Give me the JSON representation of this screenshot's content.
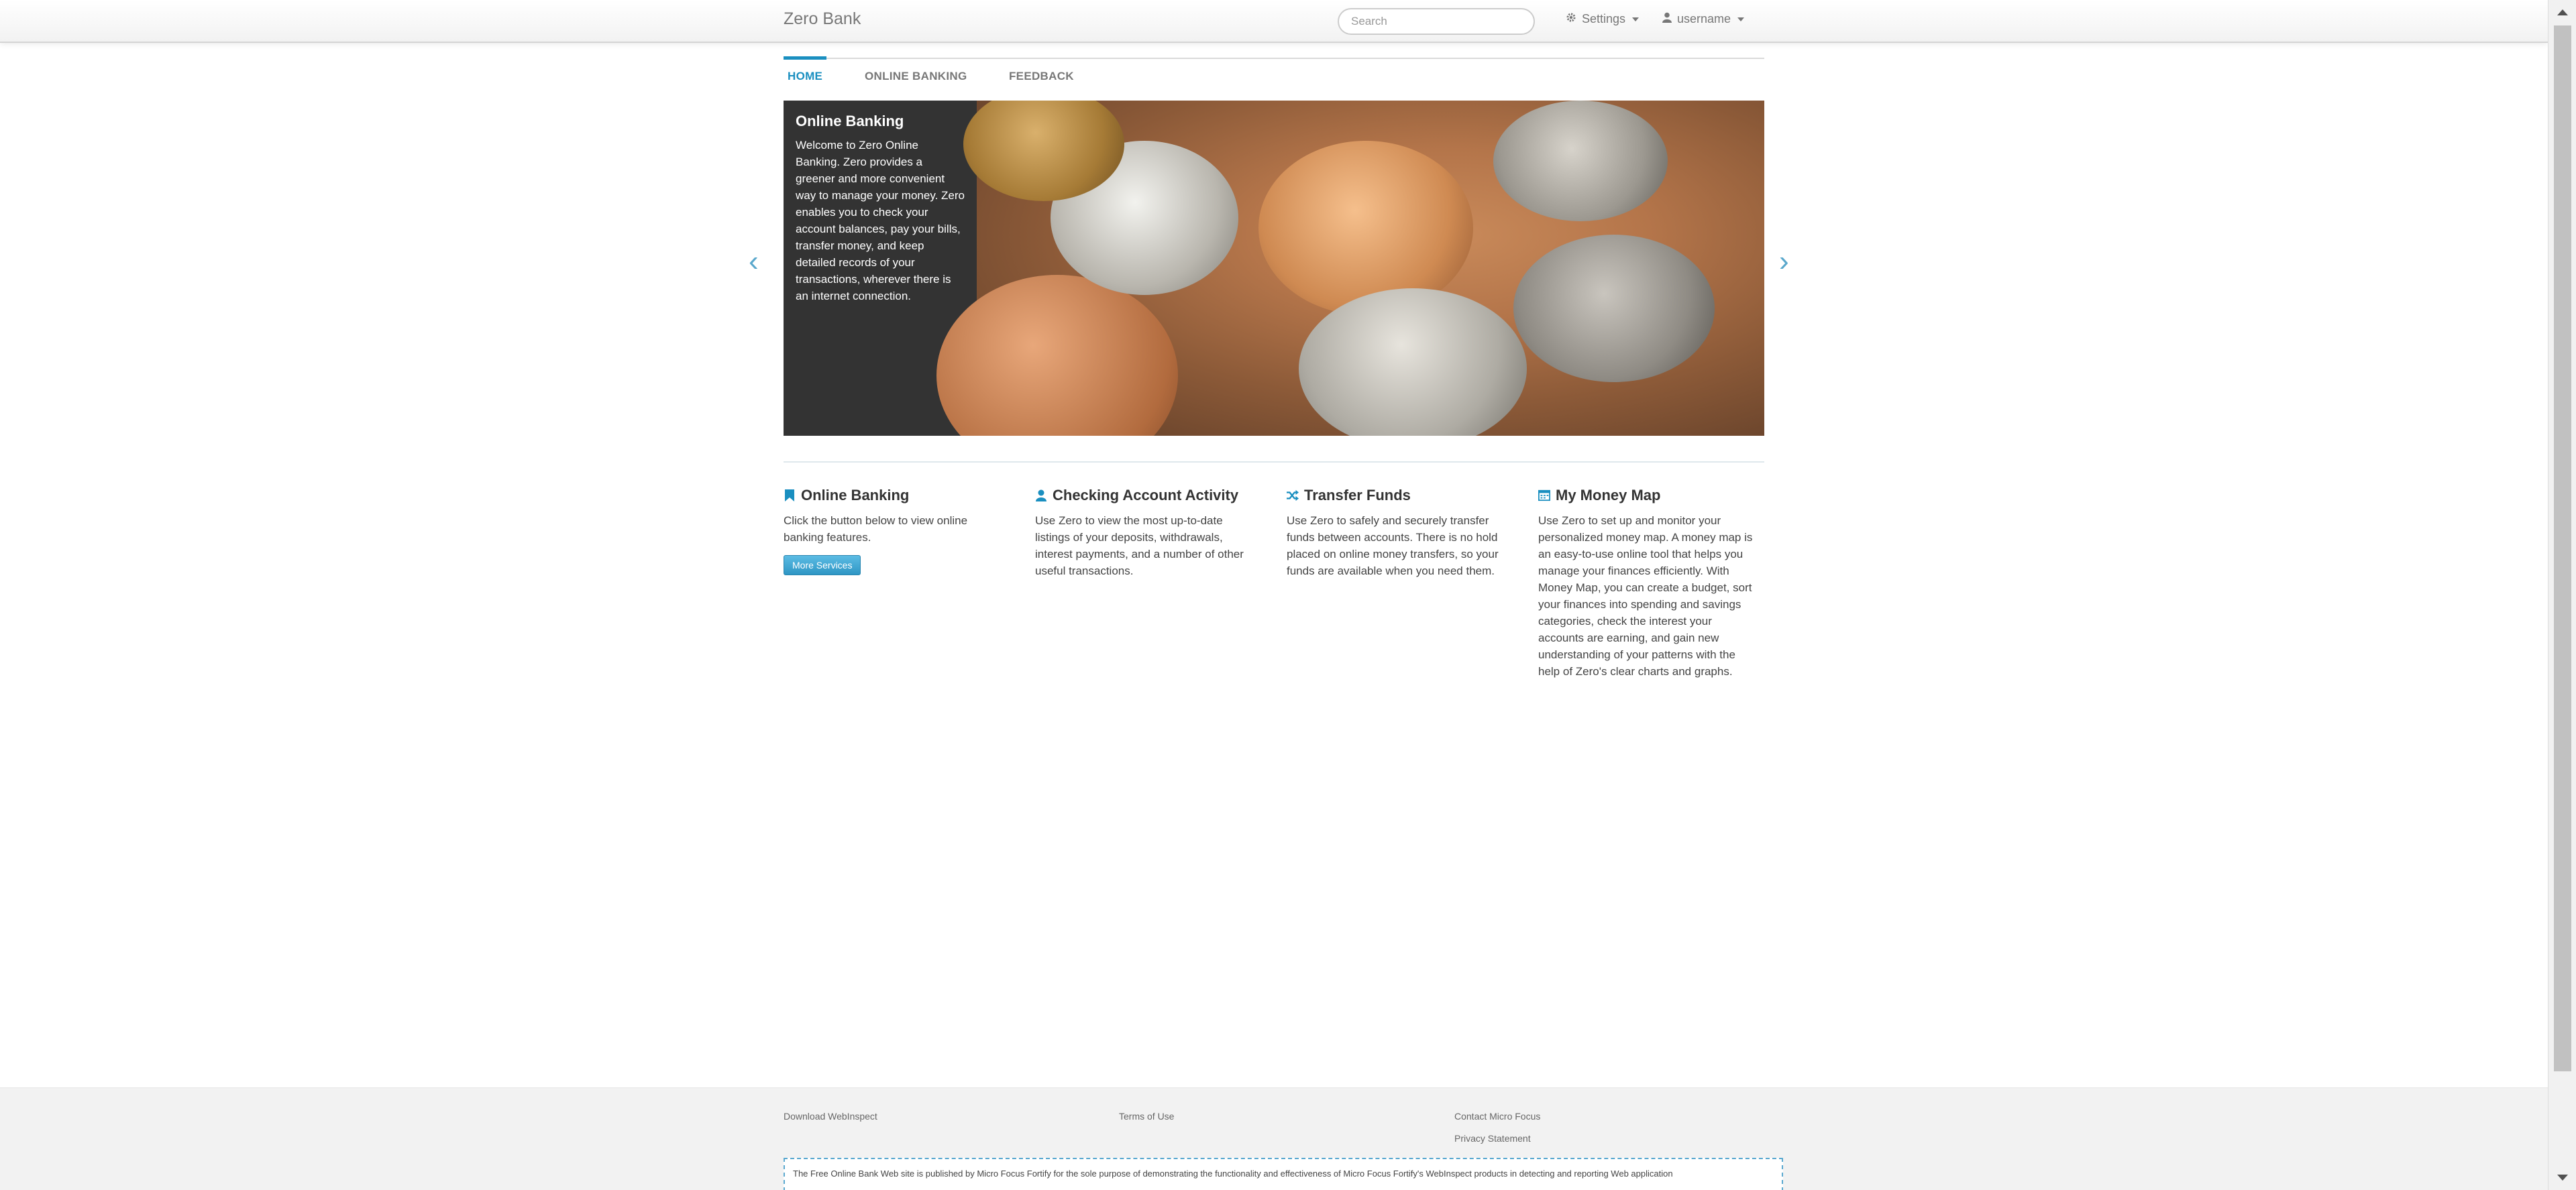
{
  "navbar": {
    "brand": "Zero Bank",
    "search_placeholder": "Search",
    "settings_label": "Settings",
    "user_label": "username"
  },
  "tabs": [
    {
      "label": "HOME",
      "active": true
    },
    {
      "label": "ONLINE BANKING",
      "active": false
    },
    {
      "label": "FEEDBACK",
      "active": false
    }
  ],
  "carousel": {
    "caption_title": "Online Banking",
    "caption_text": "Welcome to Zero Online Banking. Zero provides a greener and more convenient way to manage your money. Zero enables you to check your account balances, pay your bills, transfer money, and keep detailed records of your transactions, wherever there is an internet connection.",
    "prev_glyph": "‹",
    "next_glyph": "›"
  },
  "features": [
    {
      "title": "Online Banking",
      "icon": "bookmark-icon",
      "text": "Click the button below to view online banking features.",
      "button": "More Services"
    },
    {
      "title": "Checking Account Activity",
      "icon": "user-icon",
      "text": "Use Zero to view the most up-to-date listings of your deposits, withdrawals, interest payments, and a number of other useful transactions."
    },
    {
      "title": "Transfer Funds",
      "icon": "shuffle-icon",
      "text": "Use Zero to safely and securely transfer funds between accounts. There is no hold placed on online money transfers, so your funds are available when you need them."
    },
    {
      "title": "My Money Map",
      "icon": "calendar-icon",
      "text": "Use Zero to set up and monitor your personalized money map. A money map is an easy-to-use online tool that helps you manage your finances efficiently. With Money Map, you can create a budget, sort your finances into spending and savings categories, check the interest your accounts are earning, and gain new understanding of your patterns with the help of Zero's clear charts and graphs."
    }
  ],
  "footer": {
    "download": "Download WebInspect",
    "terms": "Terms of Use",
    "contact": "Contact Micro Focus",
    "privacy": "Privacy Statement",
    "disclaimer": "The Free Online Bank Web site is published by Micro Focus Fortify for the sole purpose of demonstrating the functionality and effectiveness of Micro Focus Fortify's WebInspect products in detecting and reporting Web application"
  },
  "colors": {
    "accent": "#1a8fc0",
    "caption_bg": "#333333",
    "footer_bg": "#f2f2f2"
  }
}
